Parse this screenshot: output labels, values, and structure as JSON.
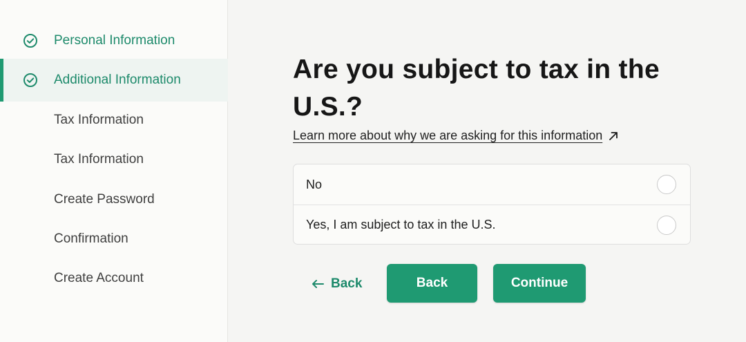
{
  "sidebar": {
    "items": [
      {
        "label": "Personal Information",
        "state": "done",
        "icon": "check-circle-icon"
      },
      {
        "label": "Additional Information",
        "state": "active",
        "icon": "check-circle-icon"
      },
      {
        "label": "Tax Information",
        "state": "pending"
      },
      {
        "label": "Tax Information",
        "state": "pending"
      },
      {
        "label": "Create Password",
        "state": "pending"
      },
      {
        "label": "Confirmation",
        "state": "pending"
      },
      {
        "label": "Create Account",
        "state": "pending"
      }
    ]
  },
  "main": {
    "title": "Are you subject to tax in the U.S.?",
    "learn_more": "Learn more about why we are asking for this information",
    "learn_more_icon": "external-arrow-icon",
    "options": [
      {
        "label": "No",
        "selected": false
      },
      {
        "label": "Yes, I am subject to tax in the U.S.",
        "selected": false
      }
    ],
    "back_link_label": "Back",
    "back_link_icon": "arrow-left-icon",
    "back_button_label": "Back",
    "continue_button_label": "Continue"
  },
  "colors": {
    "accent": "#1f9a72",
    "accent_text": "#1d8a6b",
    "sidebar_active_bg": "#eef4f1"
  }
}
